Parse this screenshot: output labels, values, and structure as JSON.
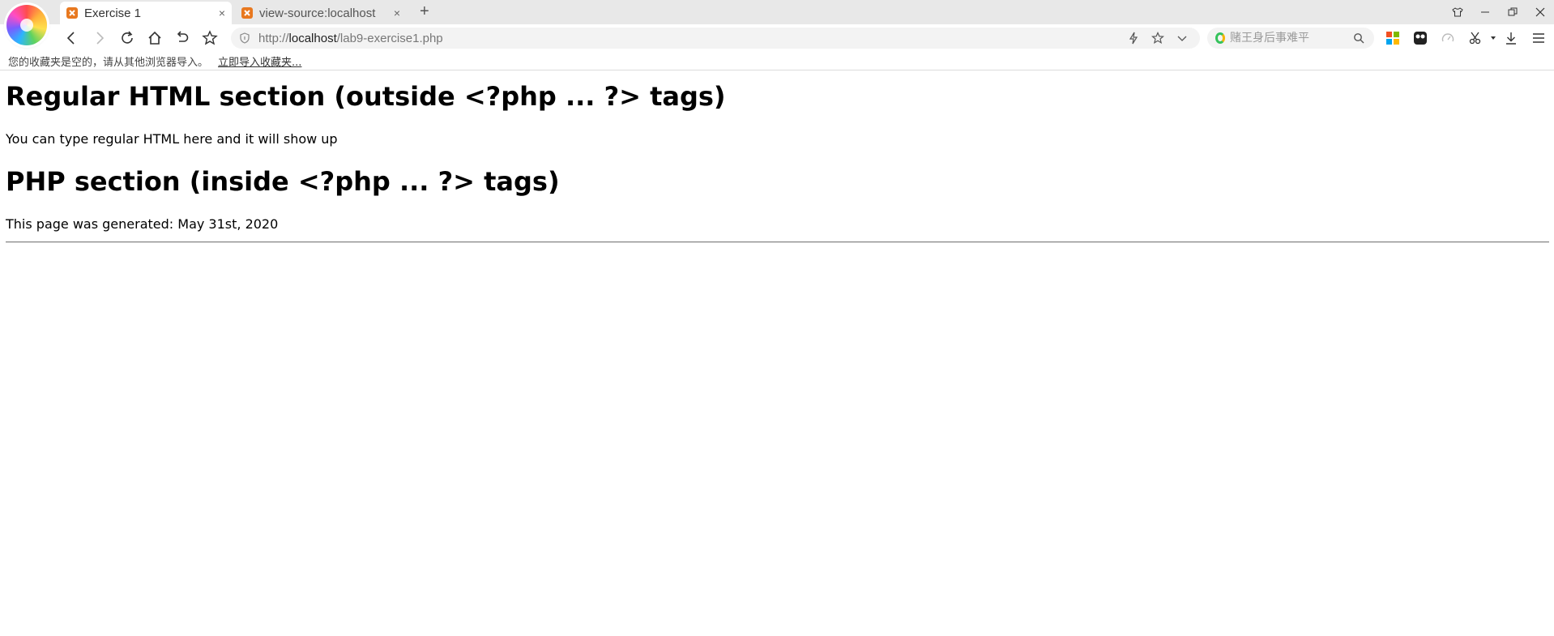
{
  "browser": {
    "tabs": [
      {
        "title": "Exercise 1",
        "close": "×",
        "active": true
      },
      {
        "title": "view-source:localhost",
        "close": "×",
        "active": false
      }
    ],
    "new_tab": "+",
    "address": {
      "scheme": "http://",
      "host": "localhost",
      "path": "/lab9-exercise1.php"
    },
    "search": {
      "placeholder": "赌王身后事难平"
    },
    "bookmarks_bar": {
      "message": "您的收藏夹是空的，请从其他浏览器导入。",
      "import_link": "立即导入收藏夹..."
    }
  },
  "page": {
    "heading1": "Regular HTML section (outside <?php ... ?> tags)",
    "paragraph1": "You can type regular HTML here and it will show up",
    "heading2": "PHP section (inside <?php ... ?> tags)",
    "paragraph2": "This page was generated: May 31st, 2020"
  },
  "colors": {
    "accent_favicon": "#e8781f",
    "tab_strip": "#e8e8e8"
  }
}
